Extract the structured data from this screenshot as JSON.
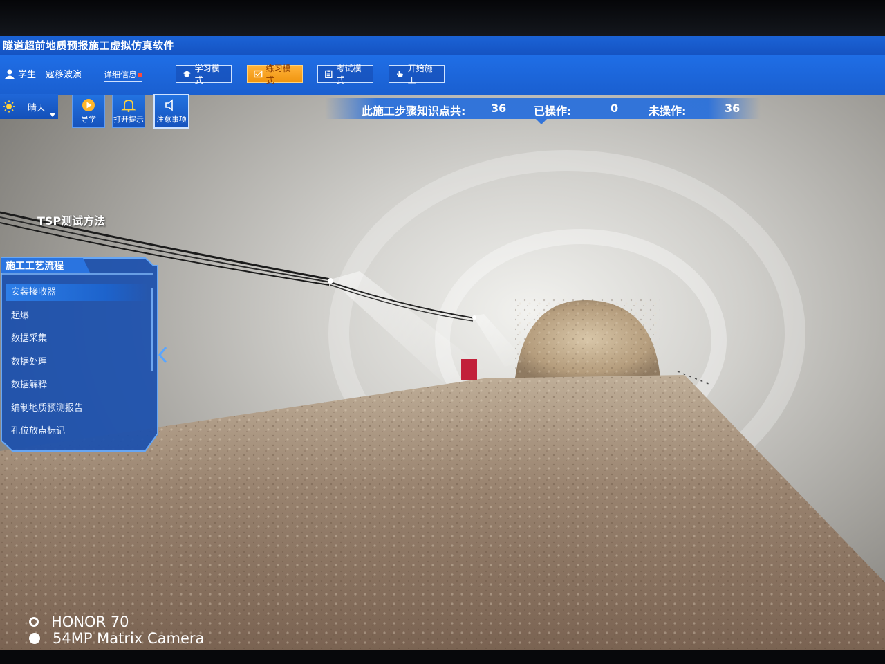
{
  "window": {
    "title": "隧道超前地质预报施工虚拟仿真软件"
  },
  "user": {
    "role": "学生",
    "name": "寇移波演",
    "detail_link": "详细信息"
  },
  "modes": [
    {
      "label": "学习模式",
      "icon": "graduation-cap-icon",
      "active": false
    },
    {
      "label": "练习模式",
      "icon": "practice-icon",
      "active": true
    },
    {
      "label": "考试模式",
      "icon": "clipboard-icon",
      "active": false
    },
    {
      "label": "开始施工",
      "icon": "hand-pointer-icon",
      "active": false
    }
  ],
  "weather": {
    "label": "晴天",
    "icon": "sun-icon"
  },
  "tool_buttons": [
    {
      "label": "导学",
      "icon": "play-circle-icon"
    },
    {
      "label": "打开提示",
      "icon": "bell-icon"
    },
    {
      "label": "注意事项",
      "icon": "speaker-icon"
    }
  ],
  "stats": {
    "total_label": "此施工步骤知识点共:",
    "total": "36",
    "done_label": "已操作:",
    "done": "0",
    "todo_label": "未操作:",
    "todo": "36"
  },
  "scene": {
    "method_label": "TSP测试方法"
  },
  "process_panel": {
    "title": "施工工艺流程",
    "steps": [
      "安装接收器",
      "起爆",
      "数据采集",
      "数据处理",
      "数据解释",
      "编制地质预测报告",
      "孔位放点标记"
    ],
    "active_index": 0
  },
  "watermark": {
    "device": "HONOR 70",
    "camera": "54MP Matrix Camera"
  },
  "colors": {
    "header_blue": "#1a5fd0",
    "active_mode": "#f09510",
    "panel_blue": "#1a4fae"
  }
}
